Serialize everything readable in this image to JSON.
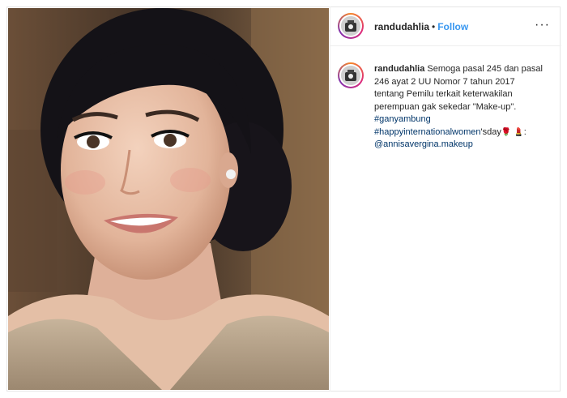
{
  "post": {
    "username": "randudahlia",
    "separator": "•",
    "follow_label": "Follow",
    "more_label": "···"
  },
  "caption": {
    "username": "randudahlia",
    "text_1": "Semoga pasal 245 dan pasal 246 ayat 2 UU Nomor 7 tahun 2017 tentang Pemilu terkait keterwakilan perempuan gak sekedar \"Make-up\". ",
    "hashtag_1": "#ganyambung",
    "hashtag_2_a": "#happyinternationalwomen",
    "hashtag_2_b": "'sday",
    "emoji_1": "🌹",
    "emoji_2": "💄",
    "text_2": ": ",
    "mention": "@annisavergina.makeup"
  },
  "colors": {
    "link": "#003569",
    "follow": "#3897f0"
  },
  "icons": {
    "more": "more-options-icon",
    "avatar": "profile-avatar-icon"
  }
}
